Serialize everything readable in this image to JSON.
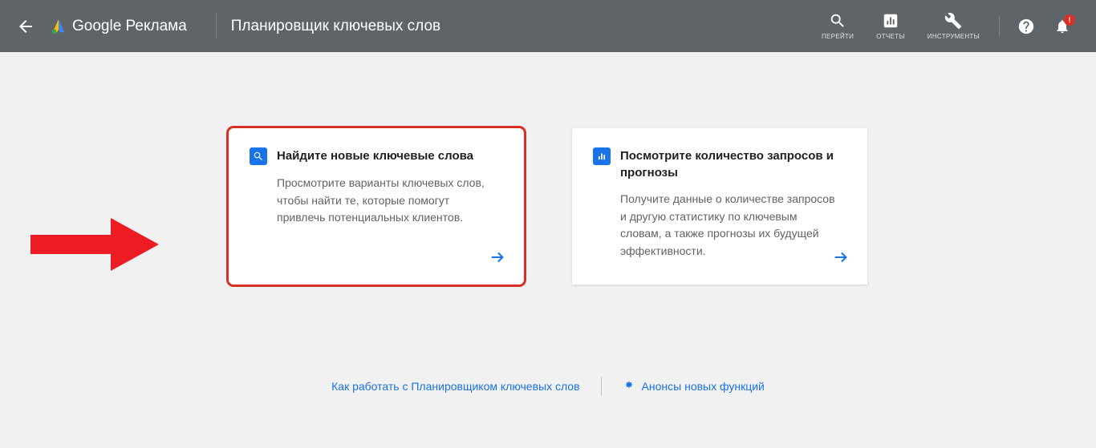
{
  "header": {
    "logo_text": "Google Реклама",
    "page_title": "Планировщик ключевых слов",
    "actions": {
      "go": "ПЕРЕЙТИ",
      "reports": "ОТЧЕТЫ",
      "tools": "ИНСТРУМЕНТЫ"
    },
    "badge": "!"
  },
  "cards": {
    "find": {
      "title": "Найдите новые ключевые слова",
      "body": "Просмотрите варианты ключевых слов, чтобы найти те, которые помогут привлечь потенциальных клиентов."
    },
    "forecast": {
      "title": "Посмотрите количество запросов и прогнозы",
      "body": "Получите данные о количестве запросов и другую статистику по ключевым словам, а также прогнозы их будущей эффективности."
    }
  },
  "footer": {
    "how_to": "Как работать с Планировщиком ключевых слов",
    "announce": "Анонсы новых функций"
  }
}
